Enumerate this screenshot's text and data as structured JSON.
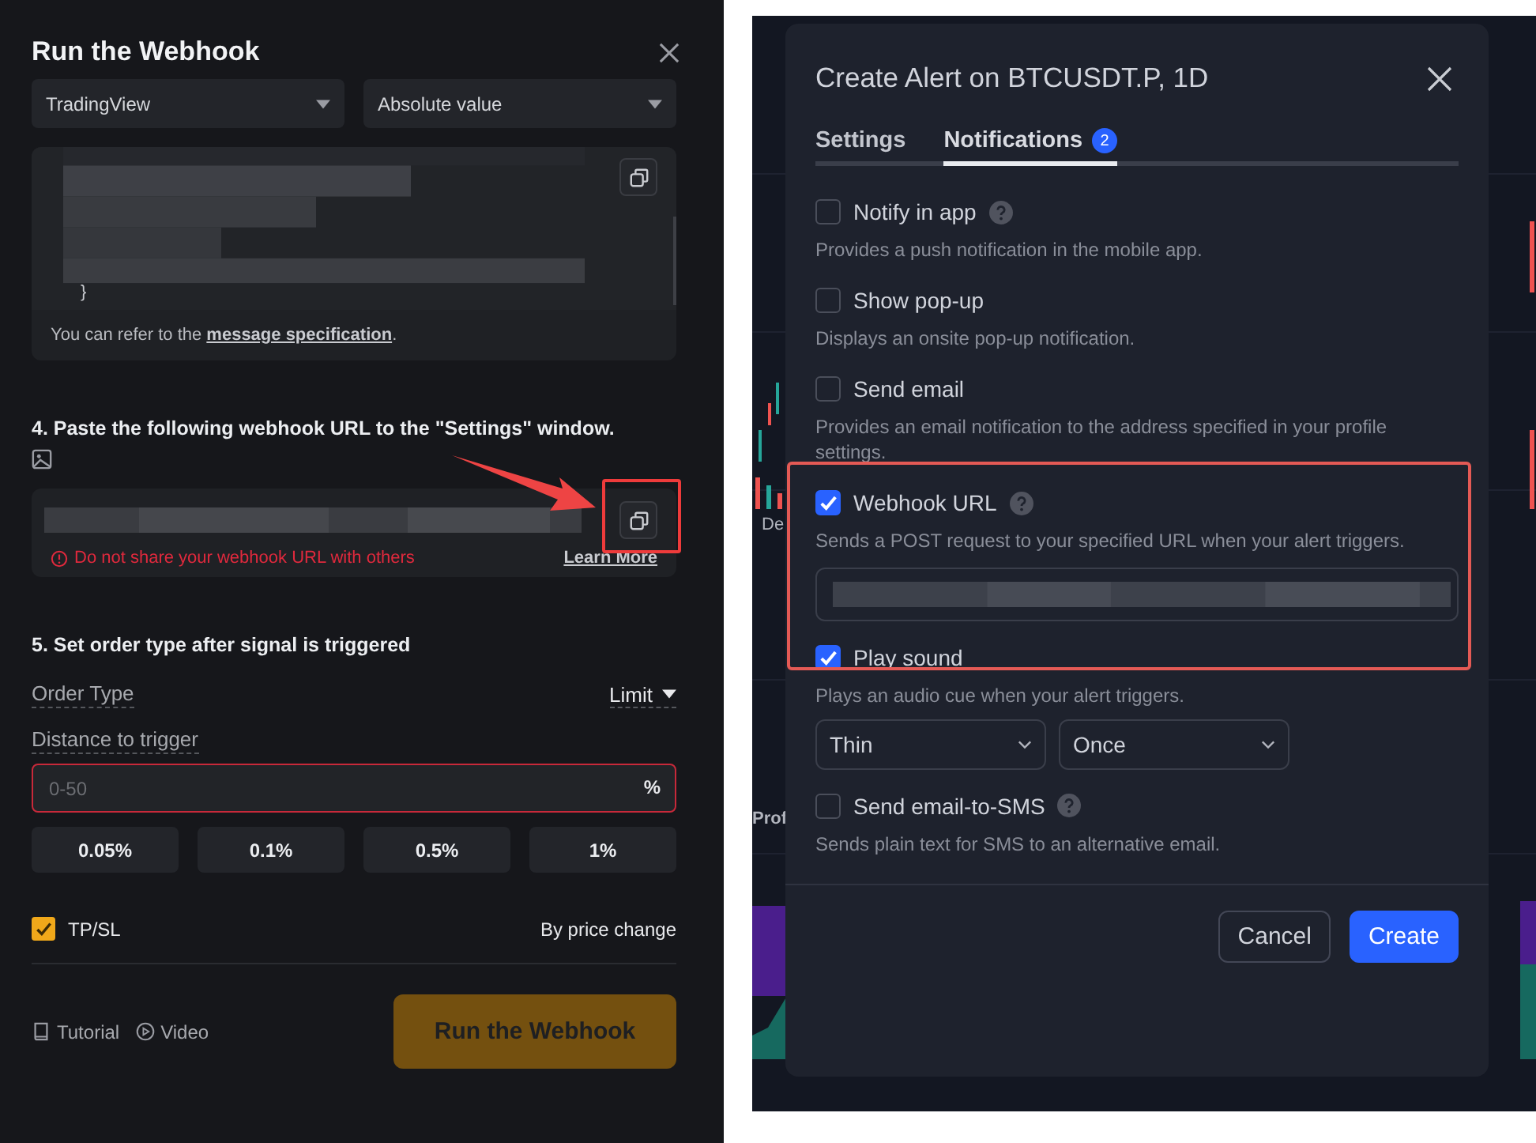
{
  "left_panel": {
    "title": "Run the Webhook",
    "selects": [
      "TradingView",
      "Absolute value"
    ],
    "code_block": {
      "closing_brace": "}",
      "note_prefix": "You can refer to the ",
      "note_link": "message specification",
      "note_suffix": "."
    },
    "step4": {
      "heading": "4. Paste the following webhook URL to the \"Settings\" window.",
      "warning": "Do not share your webhook URL with others",
      "link": "Learn More"
    },
    "step5": {
      "heading": "5. Set order type after signal is triggered",
      "order_type_label": "Order Type",
      "order_type_value": "Limit",
      "distance_label": "Distance to trigger",
      "distance_placeholder": "0-50",
      "distance_unit": "%",
      "presets": [
        "0.05%",
        "0.1%",
        "0.5%",
        "1%"
      ],
      "tpsl": {
        "label": "TP/SL",
        "checked": true,
        "mode": "By price change"
      }
    },
    "footer": {
      "links": [
        "Tutorial",
        "Video"
      ],
      "button": "Run the Webhook"
    }
  },
  "chart_fragments": [
    "De",
    "Prof"
  ],
  "alert_dialog": {
    "title": "Create Alert on BTCUSDT.P, 1D",
    "tabs": [
      {
        "label": "Settings",
        "selected": false
      },
      {
        "label": "Notifications",
        "selected": true,
        "badge": "2"
      }
    ],
    "options": [
      {
        "kind": "plain",
        "label": "Notify in app",
        "checked": false,
        "help": true,
        "description": "Provides a push notification in the mobile app."
      },
      {
        "kind": "plain",
        "label": "Show pop-up",
        "checked": false,
        "help": false,
        "description": "Displays an onsite pop-up notification."
      },
      {
        "kind": "plain",
        "label": "Send email",
        "checked": false,
        "help": false,
        "description": "Provides an email notification to the address specified in your profile settings."
      },
      {
        "kind": "url",
        "label": "Webhook URL",
        "checked": true,
        "help": true,
        "description": "Sends a POST request to your specified URL when your alert triggers."
      },
      {
        "kind": "sound",
        "label": "Play sound",
        "checked": true,
        "help": false,
        "description": "Plays an audio cue when your alert triggers.",
        "selects": [
          "Thin",
          "Once"
        ]
      },
      {
        "kind": "plain",
        "label": "Send email-to-SMS",
        "checked": false,
        "help": true,
        "description": "Sends plain text for SMS to an alternative email."
      }
    ],
    "buttons": [
      {
        "label": "Cancel",
        "kind": "secondary"
      },
      {
        "label": "Create",
        "kind": "primary"
      }
    ]
  }
}
